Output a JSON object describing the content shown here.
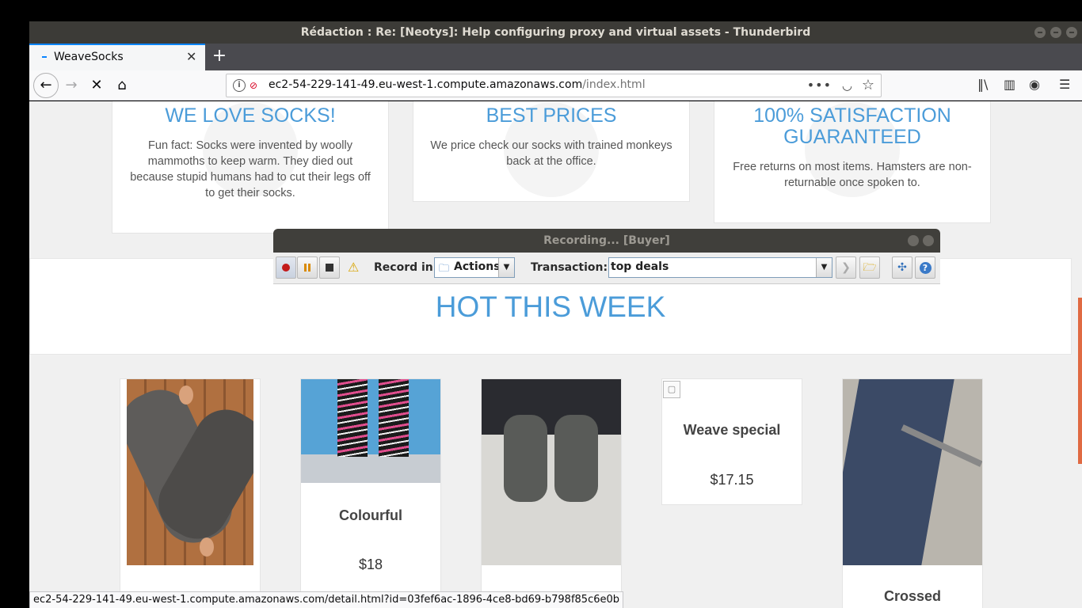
{
  "window": {
    "title": "Rédaction : Re: [Neotys]: Help configuring proxy and virtual assets - Thunderbird"
  },
  "browser": {
    "tab_title": "WeaveSocks",
    "new_tab_label": "+",
    "url_host": "ec2-54-229-141-49.eu-west-1.compute.amazonaws.com",
    "url_path": "/index.html",
    "status_url": "ec2-54-229-141-49.eu-west-1.compute.amazonaws.com/detail.html?id=03fef6ac-1896-4ce8-bd69-b798f85c6e0b"
  },
  "features": [
    {
      "title": "WE LOVE SOCKS!",
      "text": "Fun fact: Socks were invented by woolly mammoths to keep warm. They died out because stupid humans had to cut their legs off to get their socks."
    },
    {
      "title": "BEST PRICES",
      "text": "We price check our socks with trained monkeys back at the office."
    },
    {
      "title": "100% SATISFACTION GUARANTEED",
      "text": "Free returns on most items. Hamsters are non-returnable once spoken to."
    }
  ],
  "hot": {
    "heading": "HOT THIS WEEK"
  },
  "products": [
    {
      "name": "Colourful",
      "price": "$18"
    },
    {
      "name": "Weave special",
      "price": "$17.15"
    },
    {
      "name": "Crossed"
    }
  ],
  "recorder": {
    "title": "Recording... [Buyer]",
    "record_in_label": "Record in:",
    "record_in_value": "Actions",
    "transaction_label": "Transaction:",
    "transaction_value": "top deals"
  },
  "colors": {
    "accent_blue": "#4b9cd9",
    "tab_highlight": "#0a84ff",
    "scroll_indicator": "#e06a42"
  }
}
